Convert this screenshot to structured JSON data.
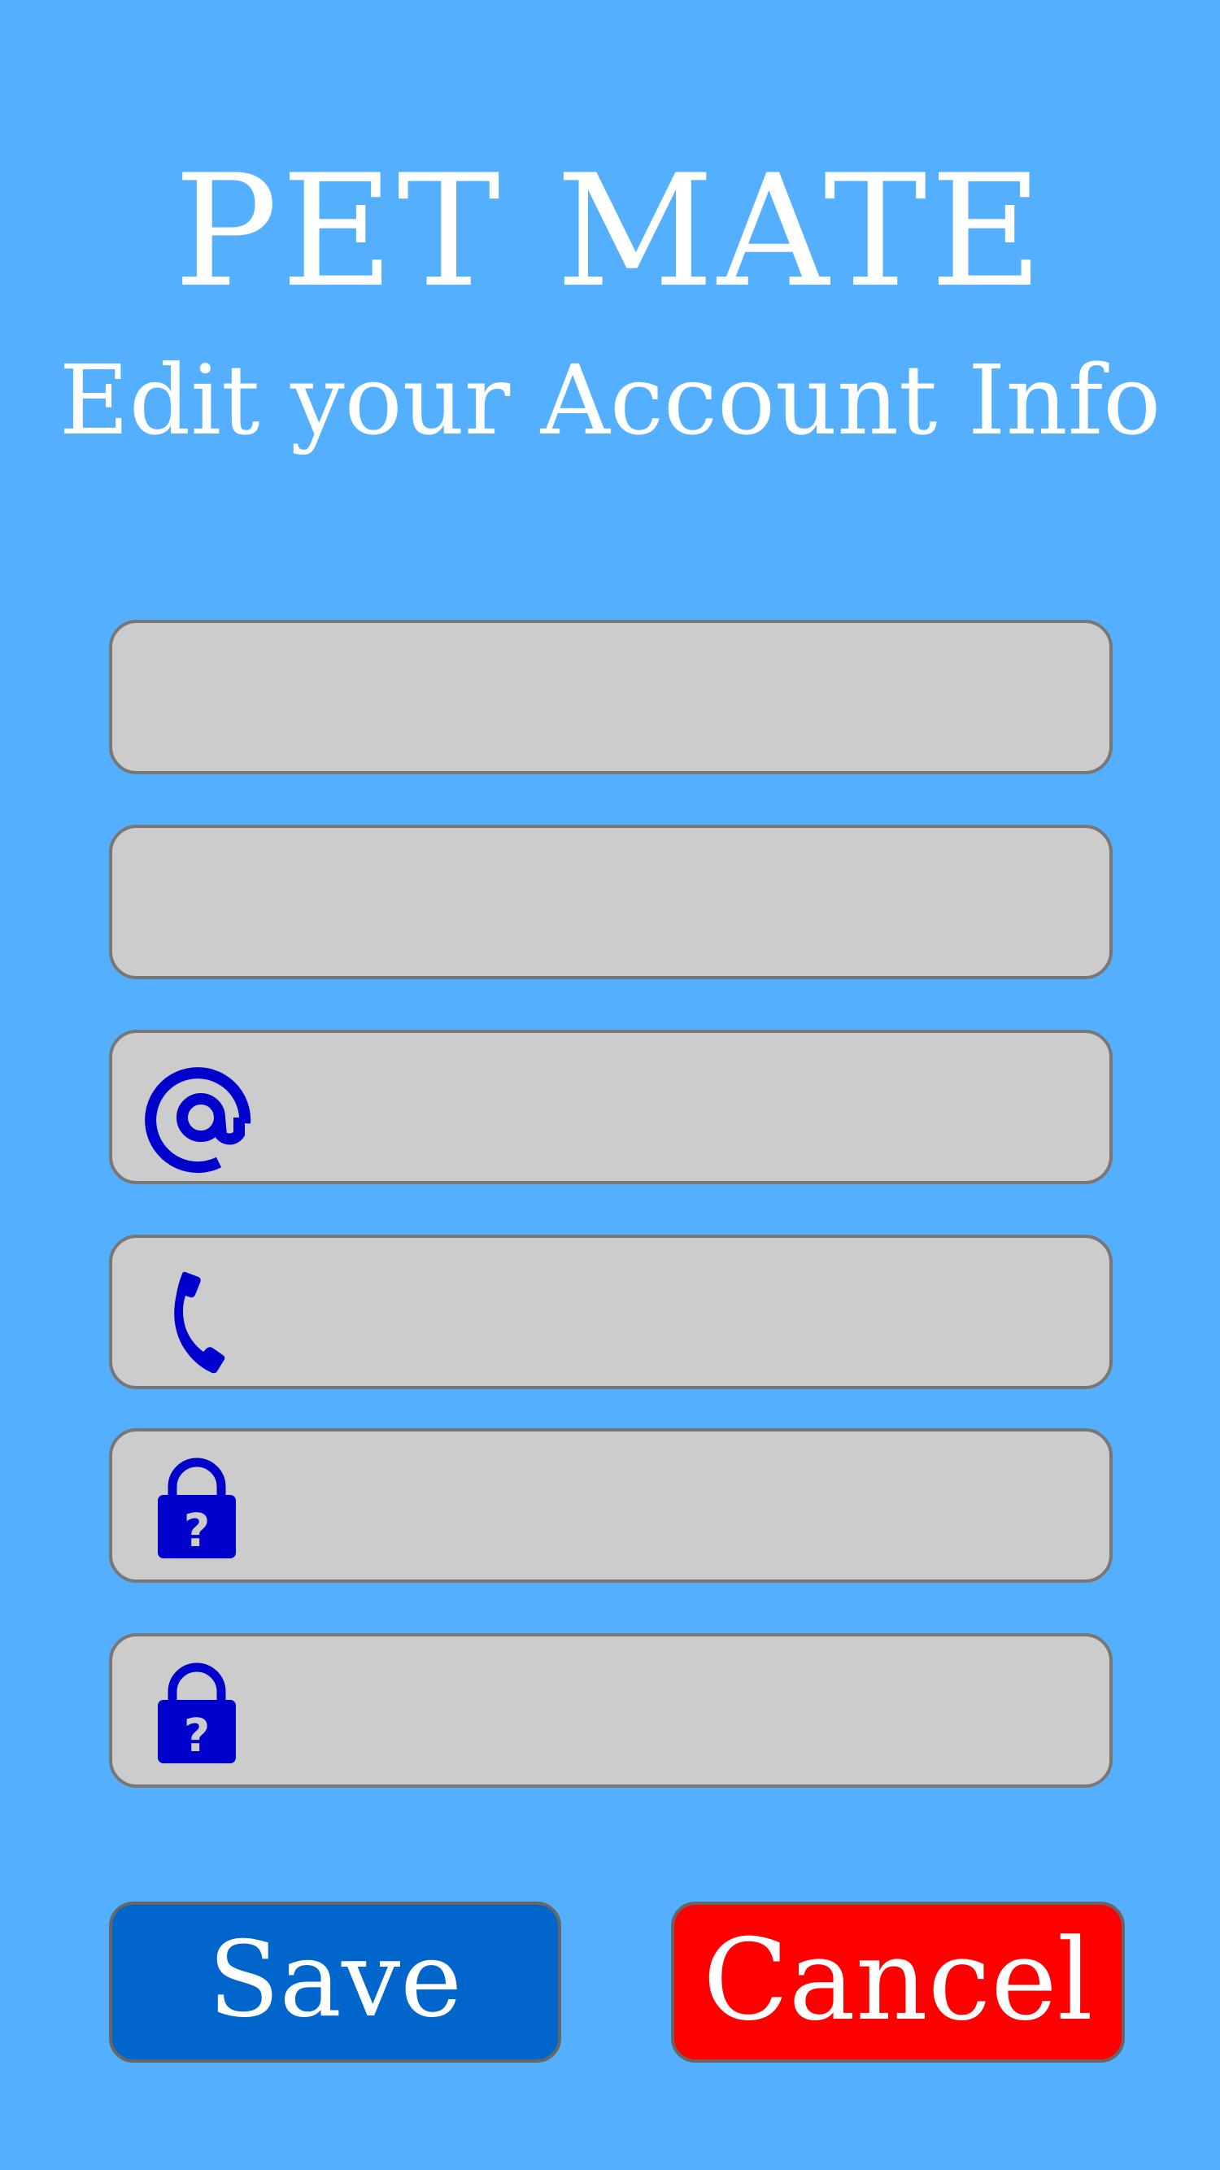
{
  "header": {
    "app_title": "PET MATE",
    "subtitle": "Edit your Account Info"
  },
  "form": {
    "fields": [
      {
        "name": "field-1",
        "icon": null,
        "value": ""
      },
      {
        "name": "field-2",
        "icon": null,
        "value": ""
      },
      {
        "name": "email",
        "icon": "at-sign-icon",
        "value": ""
      },
      {
        "name": "phone",
        "icon": "phone-icon",
        "value": ""
      },
      {
        "name": "password",
        "icon": "lock-question-icon",
        "value": ""
      },
      {
        "name": "confirm-password",
        "icon": "lock-question-icon",
        "value": ""
      }
    ]
  },
  "actions": {
    "save_label": "Save",
    "cancel_label": "Cancel"
  },
  "colors": {
    "background": "#55AFFF",
    "field_fill": "#CCCCCC",
    "field_border": "#777777",
    "icon": "#0000CC",
    "save": "#0066CC",
    "cancel": "#FF0000",
    "text": "#FFFFFF"
  }
}
